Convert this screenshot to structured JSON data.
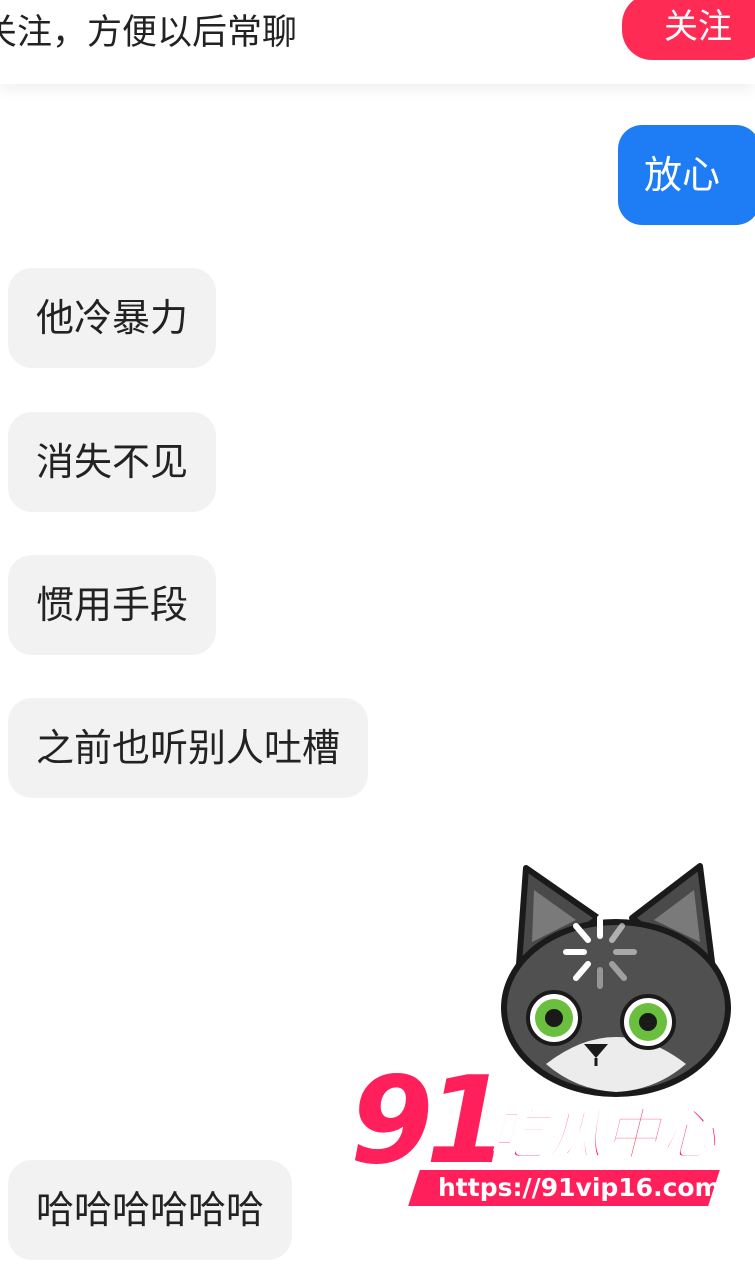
{
  "follow_banner": {
    "text": "关注，方便以后常聊",
    "button_label": "关注"
  },
  "messages": [
    {
      "direction": "out",
      "text": "放心"
    },
    {
      "direction": "in",
      "text": "他冷暴力"
    },
    {
      "direction": "in",
      "text": "消失不见"
    },
    {
      "direction": "in",
      "text": "惯用手段"
    },
    {
      "direction": "in",
      "text": "之前也听别人吐槽"
    },
    {
      "direction": "in",
      "text": "哈哈哈哈哈哈"
    }
  ],
  "sticker": {
    "icon": "loading-cat-sticker-icon"
  },
  "watermark": {
    "brand": "91",
    "title": "吃瓜中心",
    "url": "https://91vip16.com"
  },
  "colors": {
    "accent_red": "#fe2c55",
    "outgoing_bubble": "#1e7cf5",
    "incoming_bubble": "#f2f2f2",
    "watermark_pink": "#ff1f5a"
  }
}
